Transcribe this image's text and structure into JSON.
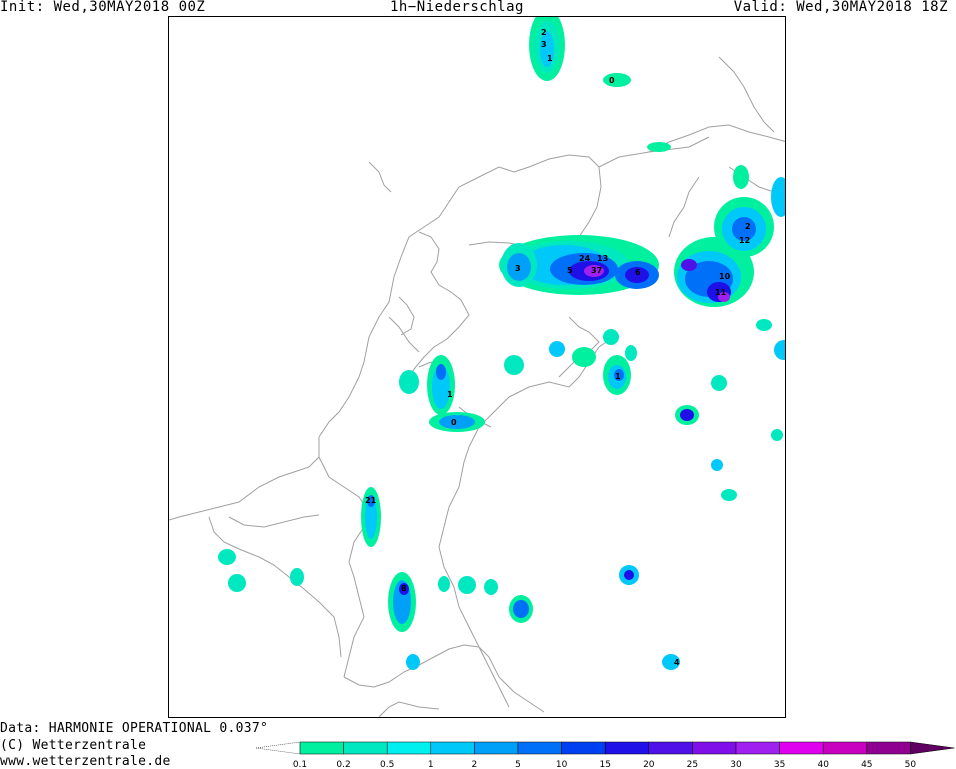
{
  "header": {
    "init": "Init: Wed,30MAY2018 00Z",
    "title": "1h−Niederschlag",
    "valid": "Valid: Wed,30MAY2018 18Z"
  },
  "footer": {
    "data_line": "Data: HARMONIE OPERATIONAL 0.037°",
    "copyright": "(C) Wetterzentrale",
    "url": "www.wetterzentrale.de"
  },
  "colorbar": {
    "levels": [
      "0.1",
      "0.2",
      "0.5",
      "1",
      "2",
      "5",
      "10",
      "15",
      "20",
      "25",
      "30",
      "35",
      "40",
      "45",
      "50"
    ],
    "colors": [
      "#00f0a0",
      "#00e8c0",
      "#00f0f0",
      "#00c8f8",
      "#00a0f8",
      "#0070f8",
      "#0040f0",
      "#2010e8",
      "#5010e8",
      "#8010e8",
      "#a020f0",
      "#e000f0",
      "#c800c0",
      "#900090",
      "#600060"
    ]
  },
  "cells": [
    {
      "label": "2",
      "value": 2
    },
    {
      "label": "3",
      "value": 3
    },
    {
      "label": "1",
      "value": 1
    },
    {
      "label": "0",
      "value": 0.3
    },
    {
      "label": "24",
      "value": 24
    },
    {
      "label": "13",
      "value": 13
    },
    {
      "label": "37",
      "value": 37
    },
    {
      "label": "5",
      "value": 5
    },
    {
      "label": "11",
      "value": 11
    },
    {
      "label": "10",
      "value": 10
    },
    {
      "label": "6",
      "value": 6
    },
    {
      "label": "4",
      "value": 4
    },
    {
      "label": "21",
      "value": 21
    },
    {
      "label": "8",
      "value": 8
    },
    {
      "label": "1",
      "value": 1
    },
    {
      "label": "0",
      "value": 0.2
    },
    {
      "label": "3",
      "value": 3
    },
    {
      "label": "12",
      "value": 12
    },
    {
      "label": "2",
      "value": 2
    },
    {
      "label": "1",
      "value": 1
    }
  ]
}
